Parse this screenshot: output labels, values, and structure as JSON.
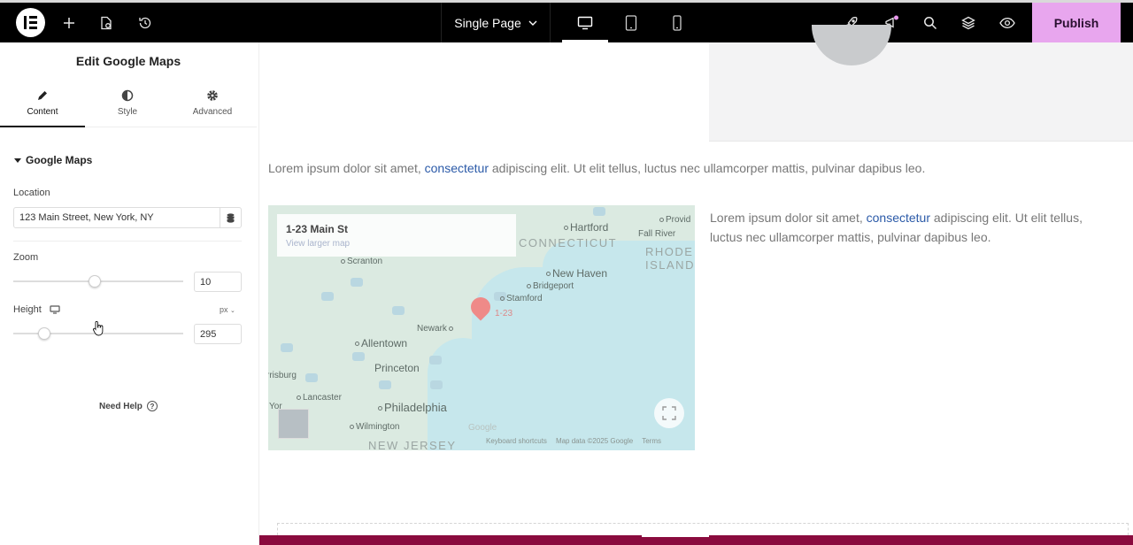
{
  "topbar": {
    "page_label": "Single Page",
    "publish_label": "Publish",
    "icons": [
      "elementor-logo-icon",
      "plus-icon",
      "page-settings-icon",
      "history-icon",
      "chevron-down-icon",
      "desktop-icon",
      "tablet-icon",
      "mobile-icon",
      "rocket-icon",
      "notifications-icon",
      "search-icon",
      "layers-icon",
      "eye-icon"
    ],
    "accent": "#e8a6ee"
  },
  "panel": {
    "title": "Edit Google Maps",
    "tabs": [
      {
        "label": "Content",
        "icon": "pencil-icon"
      },
      {
        "label": "Style",
        "icon": "half-circle-icon"
      },
      {
        "label": "Advanced",
        "icon": "gear-icon"
      }
    ],
    "section": "Google Maps",
    "location_label": "Location",
    "location_value": "123 Main Street, New York, NY",
    "zoom_label": "Zoom",
    "zoom_value": "10",
    "zoom_fraction": 0.48,
    "height_label": "Height",
    "height_unit": "px",
    "height_value": "295",
    "height_fraction": 0.18,
    "need_help": "Need Help"
  },
  "canvas": {
    "para1_before": "Lorem ipsum dolor sit amet, ",
    "para1_link": "consectetur",
    "para1_after": " adipiscing elit. Ut elit tellus, luctus nec ullamcorper mattis, pulvinar dapibus leo.",
    "para2_before": "Lorem ipsum dolor sit amet, ",
    "para2_link": "consectetur",
    "para2_after": " adipiscing elit. Ut elit tellus, luctus nec ullamcorper mattis, pulvinar dapibus leo.",
    "map": {
      "card_title": "1-23 Main St",
      "card_link": "View larger map",
      "pin_label": "1-23",
      "cities": [
        "Hartford",
        "Provid",
        "Fall River",
        "New Haven",
        "Bridgeport",
        "Stamford",
        "Scranton",
        "Newark",
        "Allentown",
        "Princeton",
        "Philadelphia",
        "Lancaster",
        "Wilmington",
        "rrisburg",
        "Yor"
      ],
      "states": [
        "CONNECTICUT",
        "RHODE",
        "ISLAND",
        "NEW JERSEY"
      ],
      "footer": [
        "Keyboard shortcuts",
        "Map data ©2025 Google",
        "Terms"
      ],
      "google": "Google"
    }
  }
}
